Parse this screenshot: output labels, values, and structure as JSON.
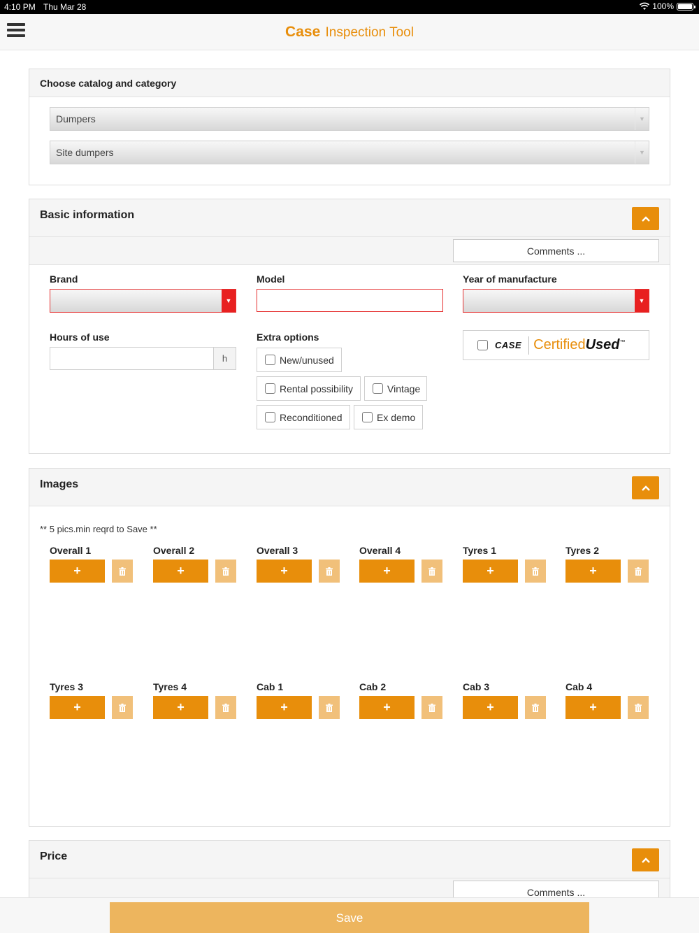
{
  "status": {
    "time": "4:10 PM",
    "date": "Thu Mar 28",
    "battery": "100%"
  },
  "header": {
    "title_bold": "Case",
    "title_rest": "Inspection Tool"
  },
  "catalog": {
    "title": "Choose catalog and category",
    "catalog_value": "Dumpers",
    "category_value": "Site dumpers"
  },
  "basic": {
    "title": "Basic information",
    "comments_label": "Comments ...",
    "brand_label": "Brand",
    "model_label": "Model",
    "year_label": "Year of manufacture",
    "hours_label": "Hours of use",
    "hours_unit": "h",
    "extra_label": "Extra options",
    "options": [
      "New/unused",
      "Rental possibility",
      "Vintage",
      "Reconditioned",
      "Ex demo"
    ],
    "certified_logo": "CASE",
    "certified_text": "Certified",
    "certified_text_bold": "Used",
    "certified_tm": "™"
  },
  "images": {
    "title": "Images",
    "note": "** 5 pics.min reqrd to Save **",
    "slots": [
      "Overall 1",
      "Overall 2",
      "Overall 3",
      "Overall 4",
      "Tyres 1",
      "Tyres 2",
      "Tyres 3",
      "Tyres 4",
      "Cab 1",
      "Cab 2",
      "Cab 3",
      "Cab 4"
    ],
    "add_symbol": "+"
  },
  "price": {
    "title": "Price",
    "comments_label": "Comments ..."
  },
  "footer": {
    "save_label": "Save"
  },
  "colors": {
    "accent": "#e88e0b",
    "accent_light": "#f1c07a",
    "error": "#e53030",
    "save": "#edb55e"
  }
}
